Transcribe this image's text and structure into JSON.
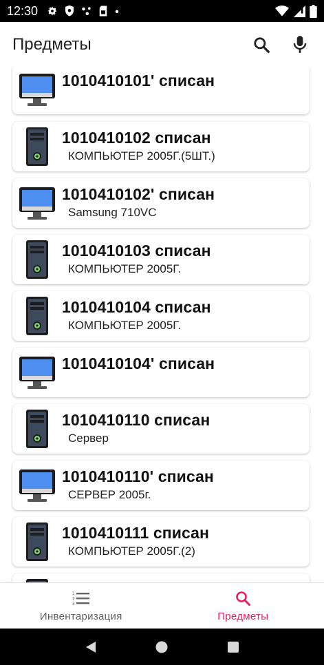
{
  "status_bar": {
    "time": "12:30",
    "icons": [
      "gear-icon",
      "shield-icon",
      "dots-icon",
      "sim-icon",
      "dot-icon",
      "wifi-icon",
      "signal-icon",
      "battery-icon"
    ]
  },
  "app_bar": {
    "title": "Предметы",
    "actions": [
      "search-icon",
      "mic-icon"
    ]
  },
  "items": [
    {
      "title": "1010410101' списан",
      "subtitle": "",
      "icon": "monitor-icon"
    },
    {
      "title": "1010410102 списан",
      "subtitle": "КОМПЬЮТЕР  2005Г.(5ШТ.)",
      "icon": "pc-tower-icon"
    },
    {
      "title": "1010410102' списан",
      "subtitle": "Samsung 710VC",
      "icon": "monitor-icon"
    },
    {
      "title": "1010410103 списан",
      "subtitle": "КОМПЬЮТЕР  2005Г.",
      "icon": "pc-tower-icon"
    },
    {
      "title": "1010410104 списан",
      "subtitle": "КОМПЬЮТЕР  2005Г.",
      "icon": "pc-tower-icon"
    },
    {
      "title": "1010410104' списан",
      "subtitle": "",
      "icon": "monitor-icon"
    },
    {
      "title": "1010410110 списан",
      "subtitle": "Сервер",
      "icon": "pc-tower-icon"
    },
    {
      "title": "1010410110' списан",
      "subtitle": "СЕРВЕР 2005г.",
      "icon": "monitor-icon"
    },
    {
      "title": "1010410111 списан",
      "subtitle": "КОМПЬЮТЕР  2005Г.(2)",
      "icon": "pc-tower-icon"
    },
    {
      "title": "",
      "subtitle": "",
      "icon": "pc-tower-icon"
    }
  ],
  "bottom_nav": {
    "inventory_label": "Инвентаризация",
    "items_label": "Предметы",
    "active": "items"
  },
  "colors": {
    "accent": "#e91e63",
    "monitor_screen": "#4d8ef0",
    "tower_body": "#3d4a5c",
    "tower_led": "#7fd36b"
  }
}
